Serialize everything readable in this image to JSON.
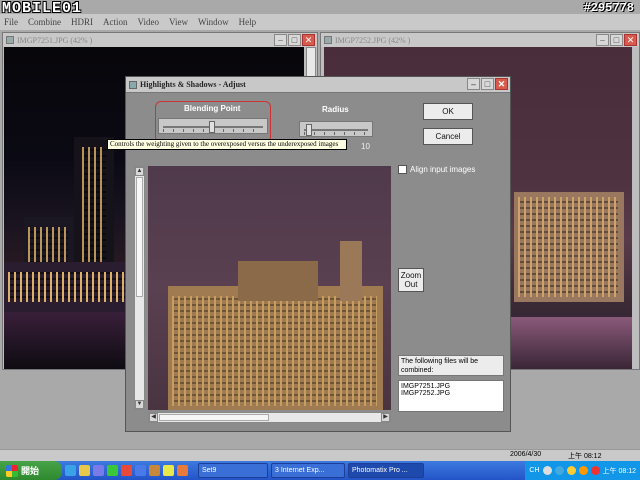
{
  "watermark": {
    "brand": "MOBILE01",
    "id": "#295778"
  },
  "menu": {
    "items": [
      "File",
      "Combine",
      "HDRI",
      "Action",
      "Video",
      "View",
      "Window",
      "Help"
    ]
  },
  "left_window": {
    "title": "IMGP7251.JPG (42% )"
  },
  "right_window": {
    "title": "IMGP7252.JPG (42% )"
  },
  "dialog": {
    "title": "Highlights & Shadows - Adjust",
    "blending_label": "Blending Point",
    "blending_value": 0.48,
    "radius_label": "Radius",
    "radius_value": "10",
    "ok": "OK",
    "cancel": "Cancel",
    "tooltip": "Controls the weighting given to the overexposed versus the underexposed images",
    "align_label": "Align input images",
    "align_checked": false,
    "zoom": "Zoom Out",
    "combine_info": "The following files will be combined:",
    "files": [
      "IMGP7251.JPG",
      "IMGP7252.JPG"
    ]
  },
  "status": {
    "date": "2006/4/30",
    "time": "上午 08:12"
  },
  "taskbar": {
    "start": "開始",
    "tasks": [
      "Set9",
      "3 Internet Exp...",
      "Photomatix Pro ..."
    ],
    "lang": "CH",
    "clock": "上午 08:12"
  },
  "colors": {
    "taskbar": "#2454c8",
    "start": "#2f8a2f",
    "close": "#d85a4a",
    "tooltip": "#ffffe1"
  }
}
